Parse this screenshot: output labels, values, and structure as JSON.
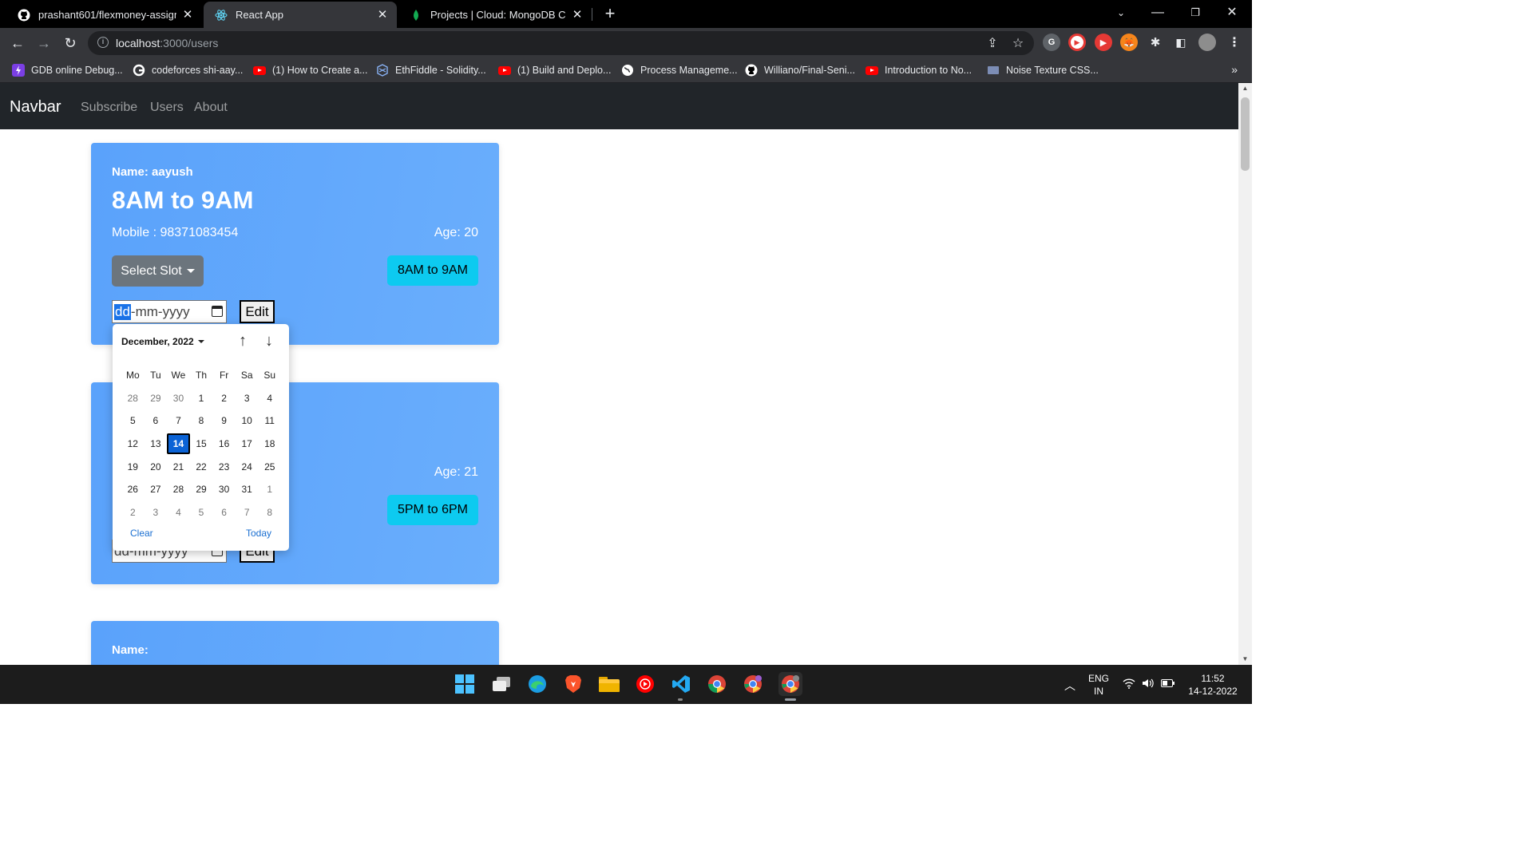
{
  "browser": {
    "tabs": [
      {
        "title": "prashant601/flexmoney-assignm",
        "icon": "github-icon",
        "active": false
      },
      {
        "title": "React App",
        "icon": "react-icon",
        "active": true
      },
      {
        "title": "Projects | Cloud: MongoDB Cloud",
        "icon": "mongodb-leaf-icon",
        "active": false
      }
    ],
    "url_host": "localhost",
    "url_path": ":3000/users",
    "bookmarks": [
      {
        "label": "GDB online Debug...",
        "icon": "gdb-icon"
      },
      {
        "label": "codeforces shi-aay...",
        "icon": "google-icon"
      },
      {
        "label": "(1) How to Create a...",
        "icon": "youtube-icon"
      },
      {
        "label": "EthFiddle - Solidity...",
        "icon": "ethfiddle-icon"
      },
      {
        "label": "(1) Build and Deplo...",
        "icon": "youtube-icon"
      },
      {
        "label": "Process Manageme...",
        "icon": "globe-icon"
      },
      {
        "label": "Williano/Final-Seni...",
        "icon": "github-icon"
      },
      {
        "label": "Introduction to No...",
        "icon": "youtube-icon"
      },
      {
        "label": "Noise Texture CSS...",
        "icon": "folder-icon"
      }
    ],
    "bookmarks_more": "»"
  },
  "app": {
    "brand": "Navbar",
    "nav_links": [
      "Subscribe",
      "Users",
      "About"
    ]
  },
  "cards": [
    {
      "name": "Name: aayush",
      "slot": "8AM to 9AM",
      "mobile": "Mobile : 98371083454",
      "age": "Age: 20",
      "select_label": "Select Slot",
      "slot_badge": "8AM to 9AM",
      "date_dd": "dd",
      "date_rest": "-mm-yyyy",
      "edit_label": "Edit"
    },
    {
      "age": "Age: 21",
      "slot_badge": "5PM to 6PM",
      "date_placeholder": "dd-mm-yyyy",
      "edit_label": "Edit"
    },
    {
      "name": "Name:"
    }
  ],
  "calendar": {
    "month_label": "December, 2022",
    "weekdays": [
      "Mo",
      "Tu",
      "We",
      "Th",
      "Fr",
      "Sa",
      "Su"
    ],
    "weeks": [
      [
        "28",
        "29",
        "30",
        "1",
        "2",
        "3",
        "4"
      ],
      [
        "5",
        "6",
        "7",
        "8",
        "9",
        "10",
        "11"
      ],
      [
        "12",
        "13",
        "14",
        "15",
        "16",
        "17",
        "18"
      ],
      [
        "19",
        "20",
        "21",
        "22",
        "23",
        "24",
        "25"
      ],
      [
        "26",
        "27",
        "28",
        "29",
        "30",
        "31",
        "1"
      ],
      [
        "2",
        "3",
        "4",
        "5",
        "6",
        "7",
        "8"
      ]
    ],
    "selected_day": "14",
    "clear_label": "Clear",
    "today_label": "Today"
  },
  "taskbar": {
    "language": "ENG",
    "region": "IN",
    "time": "11:52",
    "date": "14-12-2022"
  }
}
